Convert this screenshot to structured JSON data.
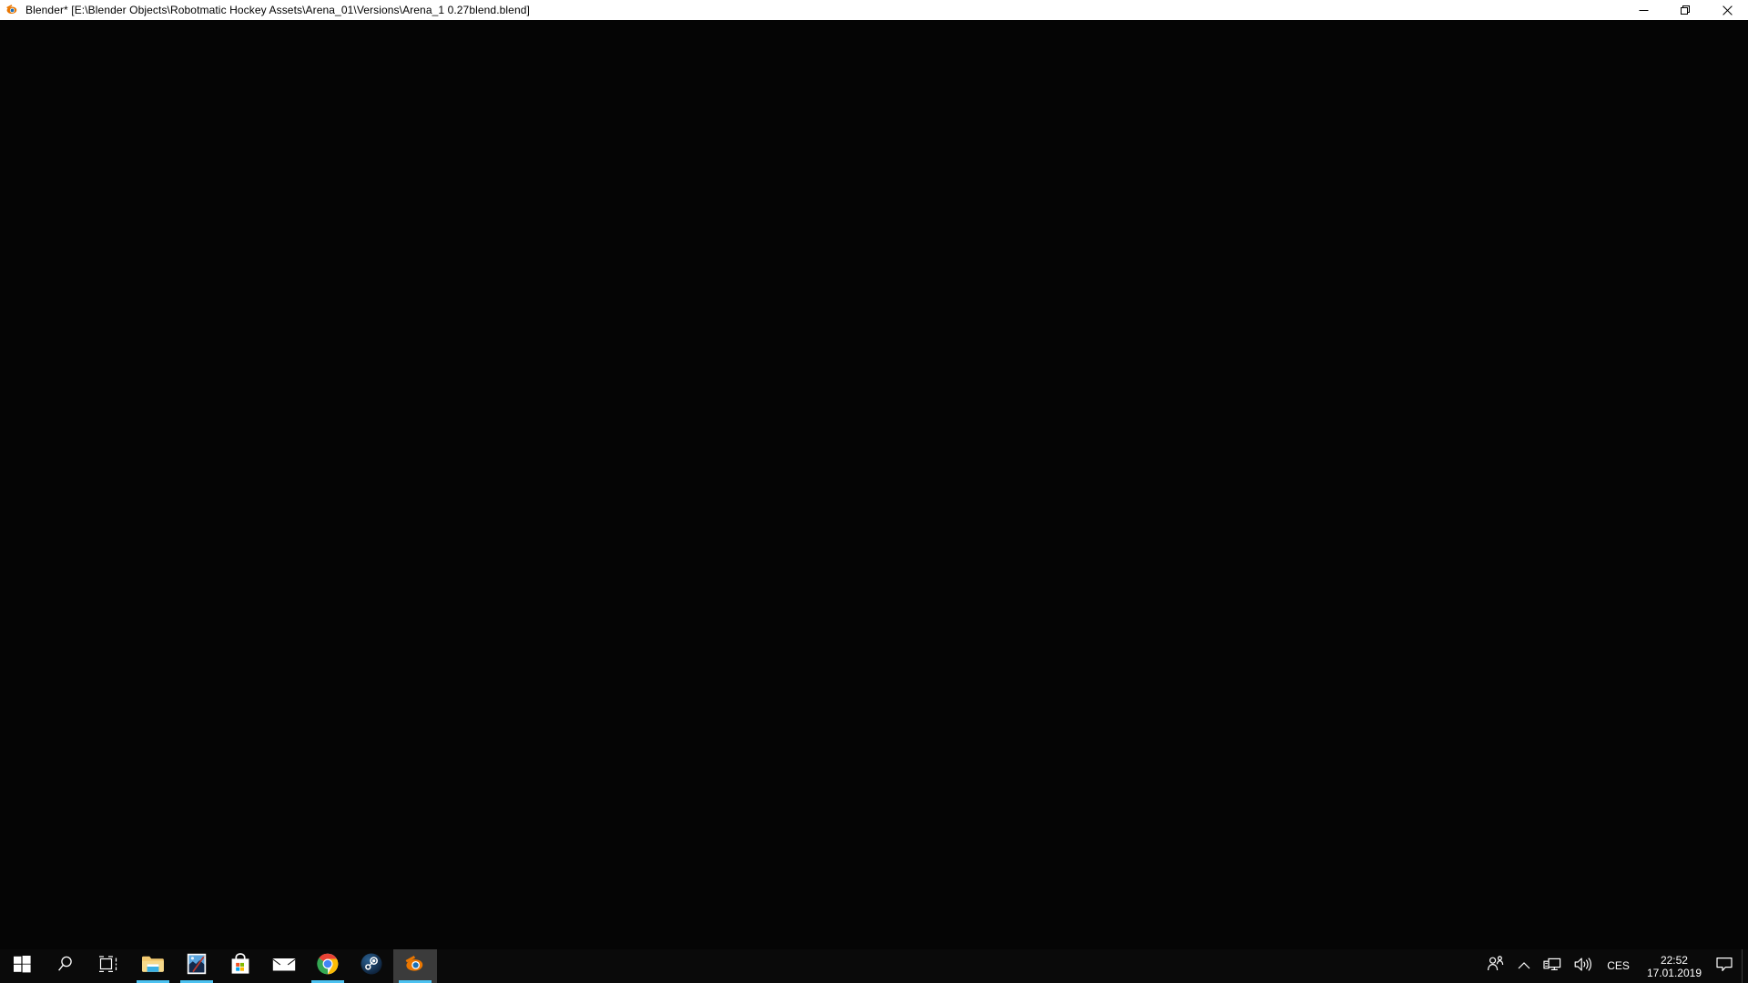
{
  "window": {
    "app_icon": "blender-icon",
    "title": "Blender* [E:\\Blender Objects\\Robotmatic Hockey Assets\\Arena_01\\Versions\\Arena_1 0.27blend.blend]",
    "controls": [
      {
        "name": "minimize",
        "label": "Minimize",
        "icon": "minimize-icon"
      },
      {
        "name": "restore",
        "label": "Restore Down",
        "icon": "restore-icon"
      },
      {
        "name": "close",
        "label": "Close",
        "icon": "close-icon"
      }
    ],
    "titlebar_bg": "#ffffff",
    "titlebar_fg": "#000000"
  },
  "viewport": {
    "background": "#050505",
    "content": ""
  },
  "taskbar": {
    "background": "#0a0a0a",
    "accent": "#4cc2f1",
    "active_button_bg": "#3b3b3b",
    "buttons": [
      {
        "name": "start-button",
        "label": "Start",
        "icon": "windows-start-icon",
        "active": false,
        "running": false
      },
      {
        "name": "search-button",
        "label": "Search",
        "icon": "search-icon",
        "active": false,
        "running": false
      },
      {
        "name": "task-view-button",
        "label": "Task View",
        "icon": "task-view-icon",
        "active": false,
        "running": false
      },
      {
        "name": "file-explorer-button",
        "label": "File Explorer",
        "icon": "folder-icon",
        "active": false,
        "running": true
      },
      {
        "name": "photos-button",
        "label": "Photos",
        "icon": "photos-icon",
        "active": false,
        "running": true
      },
      {
        "name": "microsoft-store-button",
        "label": "Microsoft Store",
        "icon": "store-bag-icon",
        "active": false,
        "running": false
      },
      {
        "name": "mail-button",
        "label": "Mail",
        "icon": "envelope-icon",
        "active": false,
        "running": false
      },
      {
        "name": "chrome-button",
        "label": "Google Chrome",
        "icon": "chrome-icon",
        "active": false,
        "running": true
      },
      {
        "name": "steam-button",
        "label": "Steam",
        "icon": "steam-icon",
        "active": false,
        "running": false
      },
      {
        "name": "blender-button",
        "label": "Blender",
        "icon": "blender-icon",
        "active": true,
        "running": true
      }
    ],
    "tray": {
      "people": {
        "name": "people-icon",
        "label": "People"
      },
      "show_hidden": {
        "name": "chevron-up-icon",
        "label": "Show hidden icons"
      },
      "network": {
        "name": "network-monitor-icon",
        "label": "Network"
      },
      "volume": {
        "name": "speaker-icon",
        "label": "Speakers"
      },
      "language": "CES",
      "clock_time": "22:52",
      "clock_date": "17.01.2019",
      "action_center": {
        "name": "action-center-icon",
        "label": "Notifications"
      },
      "show_desktop": {
        "name": "show-desktop-button",
        "label": "Show desktop"
      }
    }
  }
}
